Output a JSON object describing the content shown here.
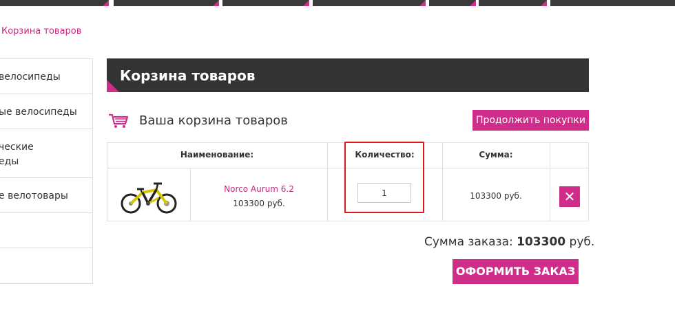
{
  "breadcrumb": {
    "current": "Корзина товаров"
  },
  "sidebar": {
    "items": [
      {
        "label": "велосипеды"
      },
      {
        "label": "ые велосипеды"
      },
      {
        "label_line1": "ческие",
        "label_line2": "еды"
      },
      {
        "label": "е велотовары"
      },
      {
        "label": ""
      },
      {
        "label": ""
      }
    ]
  },
  "header": {
    "title": "Корзина товаров"
  },
  "cart": {
    "heading": "Ваша корзина товаров",
    "continue_label": "Продолжить покупки",
    "columns": {
      "name": "Наименование:",
      "quantity": "Количество:",
      "sum": "Сумма:"
    },
    "items": [
      {
        "image_icon": "bicycle-image",
        "name": "Norco Aurum 6.2",
        "price": "103300 руб.",
        "quantity": "1",
        "sum": "103300 руб.",
        "remove_icon": "close-icon",
        "remove_glyph": "✕"
      }
    ],
    "total_label": "Сумма заказа:",
    "total_value": "103300",
    "total_currency": "руб.",
    "checkout_label": "ОФОРМИТЬ ЗАКАЗ"
  },
  "colors": {
    "accent": "#d02d8a",
    "dark": "#333333",
    "highlight": "#e0161d"
  }
}
